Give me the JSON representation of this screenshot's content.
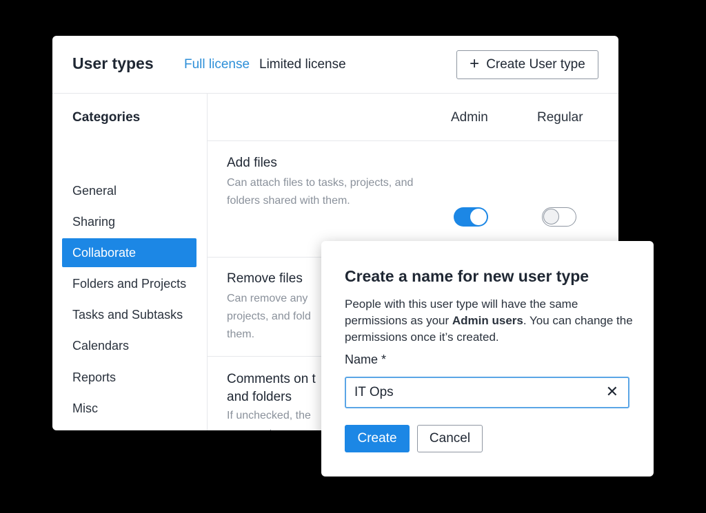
{
  "header": {
    "title": "User types",
    "tabs": [
      {
        "label": "Full license",
        "active": true
      },
      {
        "label": "Limited license",
        "active": false
      }
    ],
    "create_button_label": "Create User type",
    "create_button_icon": "plus-icon"
  },
  "sidebar": {
    "heading": "Categories",
    "items": [
      {
        "label": "General",
        "active": false
      },
      {
        "label": "Sharing",
        "active": false
      },
      {
        "label": "Collaborate",
        "active": true
      },
      {
        "label": "Folders and Projects",
        "active": false
      },
      {
        "label": "Tasks and Subtasks",
        "active": false
      },
      {
        "label": "Calendars",
        "active": false
      },
      {
        "label": "Reports",
        "active": false
      },
      {
        "label": "Misc",
        "active": false
      }
    ]
  },
  "table": {
    "columns": [
      "Admin",
      "Regular"
    ],
    "rows": [
      {
        "title": "Add files",
        "description": "Can attach files to tasks, projects, and folders shared with them.",
        "admin": true,
        "regular": false
      },
      {
        "title": "Remove files",
        "description": "Can remove any projects, and fold them."
      },
      {
        "title": "Comments on t and folders",
        "description": "If unchecked, the comments."
      }
    ]
  },
  "dialog": {
    "title": "Create a name for new user type",
    "description_before": "People with this user type will have the same permissions as your ",
    "description_bold": "Admin users",
    "description_after": ". You can change the permissions once it’s created.",
    "field_label": "Name *",
    "field_value": "IT Ops",
    "create_label": "Create",
    "cancel_label": "Cancel"
  },
  "colors": {
    "accent": "#1c87e5",
    "tab_active": "#2d8fd8",
    "background": "#000000"
  }
}
